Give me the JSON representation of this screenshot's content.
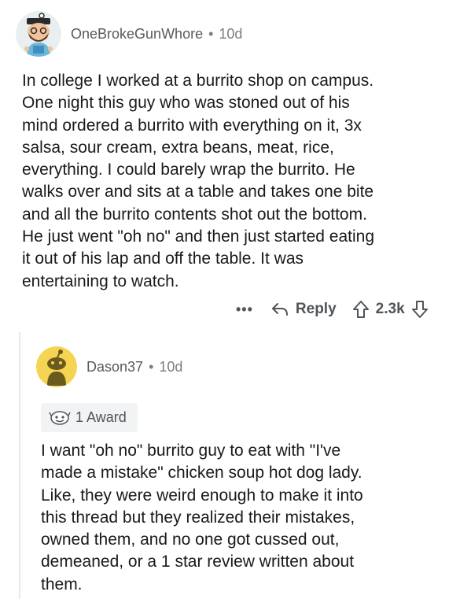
{
  "comments": [
    {
      "username": "OneBrokeGunWhore",
      "separator": "•",
      "time": "10d",
      "avatar_icon": "bearded-snoo-avatar",
      "body_lines": [
        "In college I worked at a burrito shop on campus.",
        "One night this guy who was stoned out of his",
        "mind ordered a burrito with everything on it, 3x",
        "salsa, sour cream, extra beans, meat, rice,",
        "everything. I could barely wrap the burrito. He",
        "walks over and sits at a table and takes one bite",
        "and all the burrito contents shot out the bottom.",
        "He just went \"oh no\" and then just started eating",
        "it out of his lap and off the table. It was",
        "entertaining to watch."
      ],
      "actions": {
        "more": "•••",
        "reply_label": "Reply",
        "score": "2.3k"
      }
    },
    {
      "username": "Dason37",
      "separator": "•",
      "time": "10d",
      "avatar_icon": "default-snoo-avatar",
      "award_label": "1 Award",
      "award_icon": "award-icon",
      "body_lines": [
        "I want \"oh no\" burrito guy to eat with \"I've",
        "made a mistake\" chicken soup hot dog lady.",
        "Like, they were weird enough to make it into",
        "this thread but they realized their mistakes,",
        "owned them, and no one got cussed out,",
        "demeaned, or a 1 star review written about",
        "them."
      ]
    }
  ],
  "colors": {
    "meta_gray": "#7c7c7c",
    "username_gray": "#555a5e",
    "avatar2_bg": "#f4d452",
    "avatar1_bg": "#e9eef0",
    "award_bg": "#f2f3f4"
  }
}
